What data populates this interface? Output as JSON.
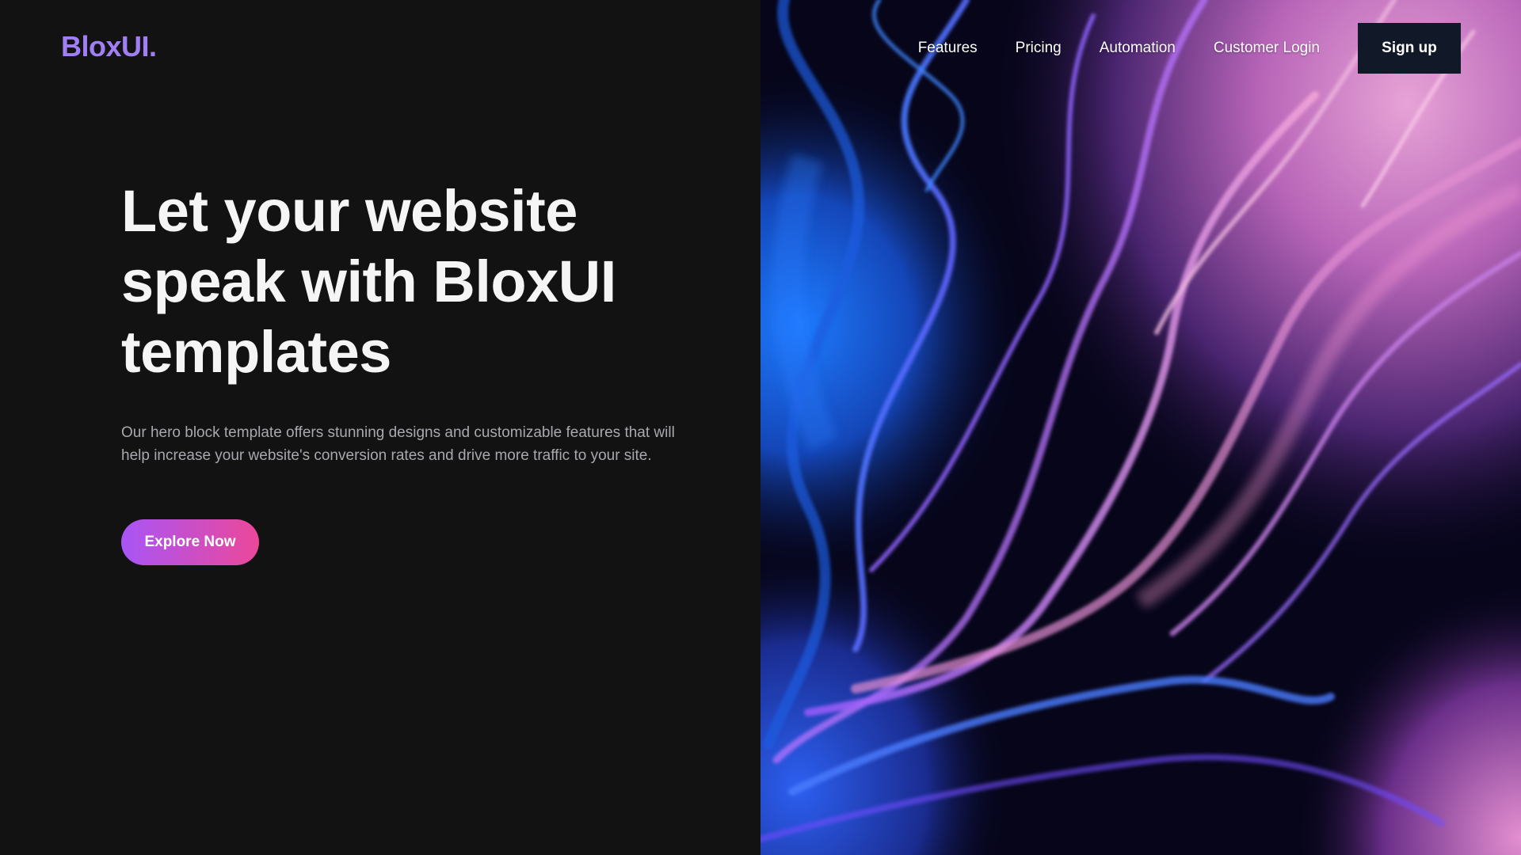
{
  "brand": {
    "logo": "BloxUI.",
    "accent": "#a07ff5"
  },
  "nav": {
    "links": [
      "Features",
      "Pricing",
      "Automation",
      "Customer Login"
    ],
    "signup_label": "Sign up"
  },
  "hero": {
    "title": "Let your website speak with BloxUI templates",
    "description": "Our hero block template offers stunning designs and customizable features that will help increase your website's conversion rates and drive more traffic to your site.",
    "cta_label": "Explore Now",
    "cta_gradient": [
      "#a855f7",
      "#ec4899"
    ]
  },
  "colors": {
    "background": "#121212",
    "button_dark": "#111827"
  }
}
